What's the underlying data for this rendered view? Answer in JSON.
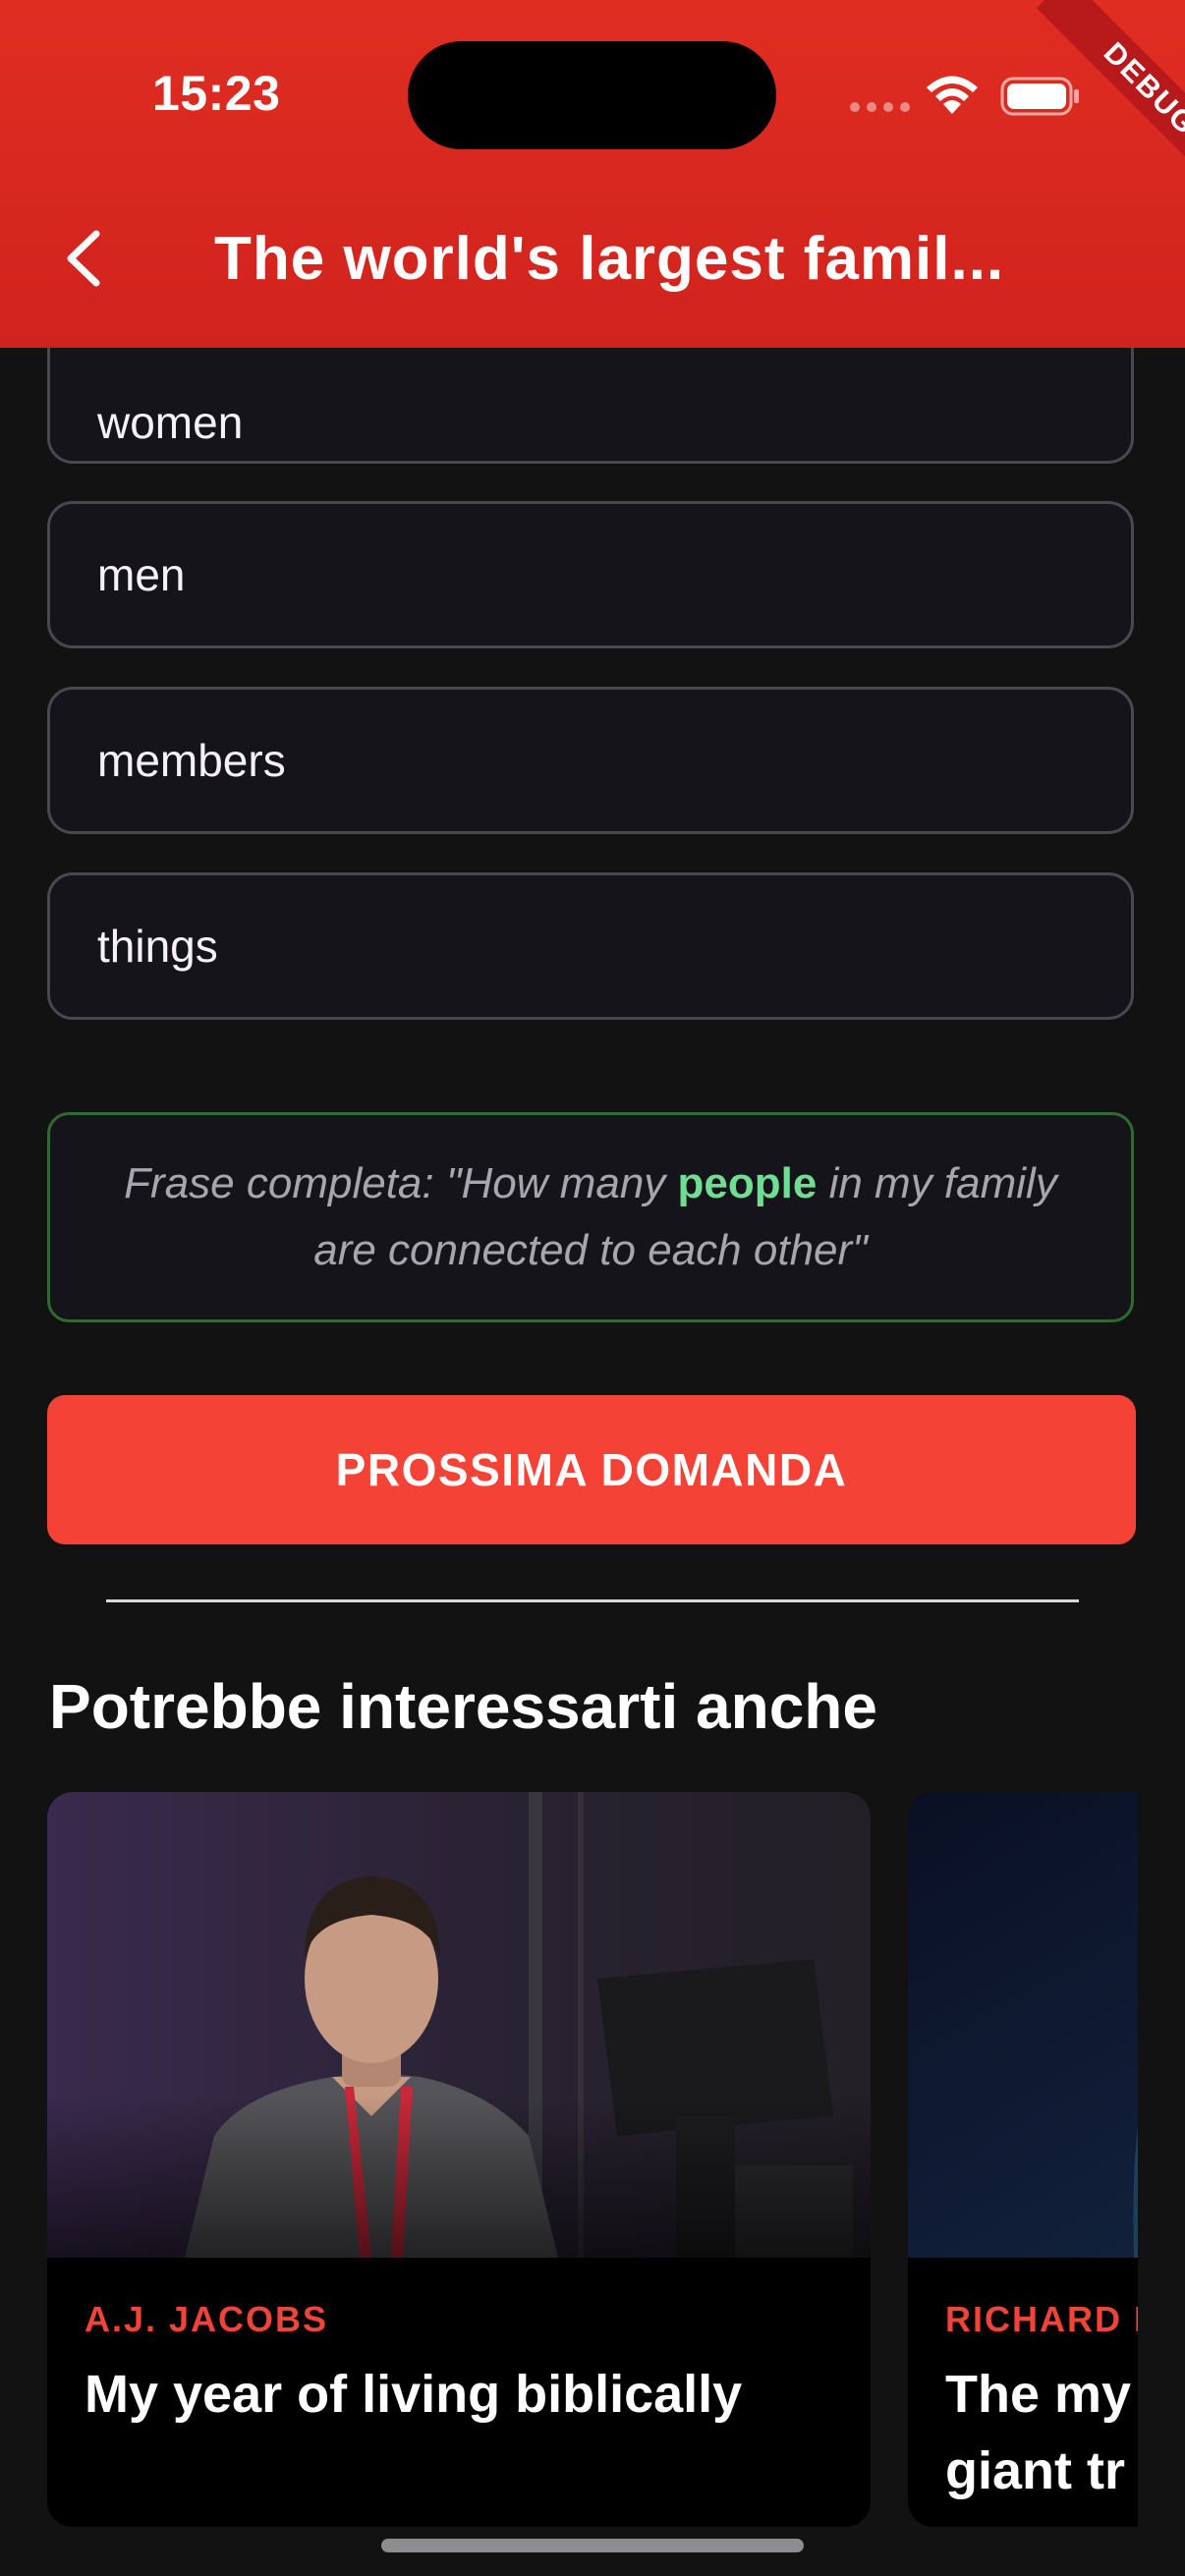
{
  "status_bar": {
    "time": "15:23"
  },
  "debug_banner": "DEBUG",
  "header": {
    "title": "The world's largest famil..."
  },
  "options": [
    {
      "label": "women"
    },
    {
      "label": "men"
    },
    {
      "label": "members"
    },
    {
      "label": "things"
    }
  ],
  "feedback": {
    "prefix": "Frase completa: \"How many ",
    "highlight": "people",
    "suffix": " in my family are connected to each other\""
  },
  "next_button": "PROSSIMA DOMANDA",
  "recommendations": {
    "title": "Potrebbe interessarti anche",
    "cards": [
      {
        "speaker": "A.J. JACOBS",
        "title": "My year of living biblically"
      },
      {
        "speaker": "RICHARD P",
        "title": "The my giant tr"
      }
    ]
  },
  "colors": {
    "header_red": "#e02d22",
    "button_red": "#f44336",
    "speaker_red": "#ef4438",
    "highlight_green": "#6fdd92",
    "background": "#121212"
  }
}
